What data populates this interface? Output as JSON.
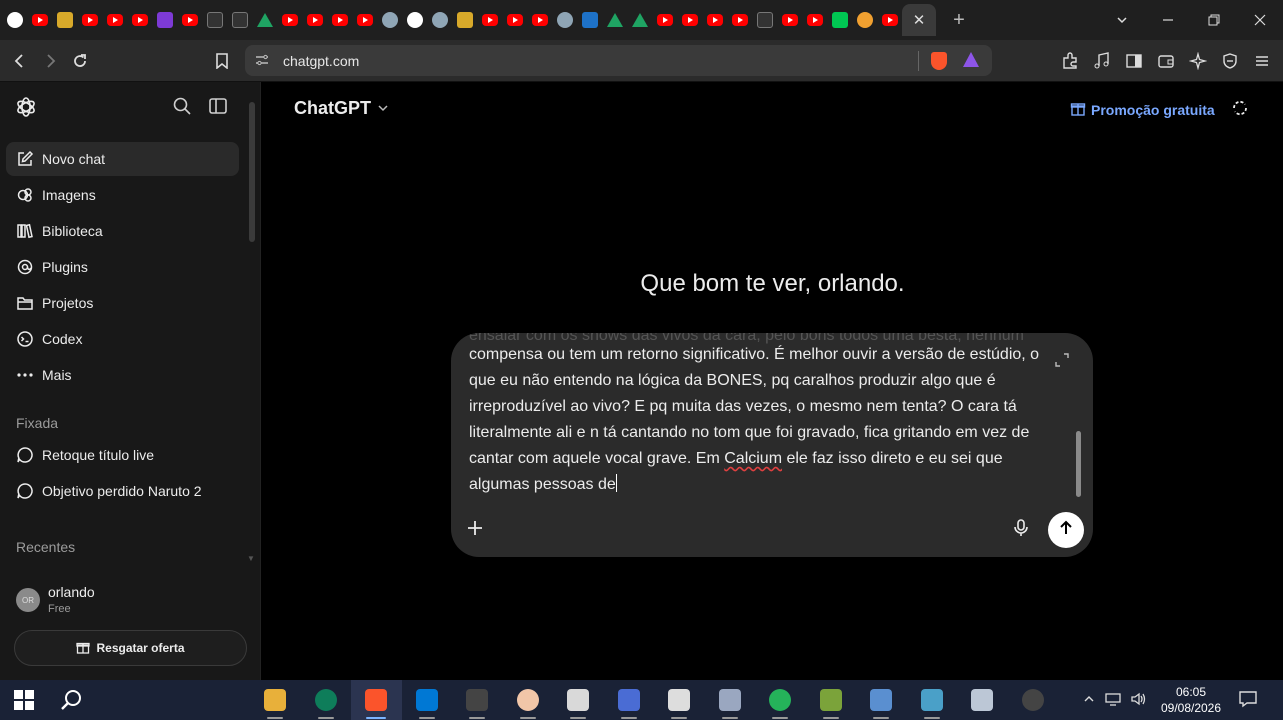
{
  "browser": {
    "url": "chatgpt.com",
    "tabs_favicons": [
      "google",
      "yt",
      "blogger",
      "yt",
      "yt",
      "yt",
      "twitch",
      "yt",
      "dark",
      "pw",
      "drive",
      "yt",
      "yt",
      "yt",
      "yt",
      "cat",
      "google",
      "cat",
      "hd",
      "yt",
      "yt",
      "yt",
      "cat",
      "blue",
      "drive",
      "drive",
      "yt",
      "yt",
      "yt",
      "yt",
      "sound",
      "yt",
      "yt",
      "kick",
      "orange",
      "yt"
    ],
    "close_tab": "✕",
    "new_tab": "+"
  },
  "sidebar": {
    "items": [
      {
        "label": "Novo chat",
        "icon": "edit-icon"
      },
      {
        "label": "Imagens",
        "icon": "images-icon"
      },
      {
        "label": "Biblioteca",
        "icon": "library-icon"
      },
      {
        "label": "Plugins",
        "icon": "plugins-icon"
      },
      {
        "label": "Projetos",
        "icon": "folder-icon"
      },
      {
        "label": "Codex",
        "icon": "codex-icon"
      },
      {
        "label": "Mais",
        "icon": "more-icon"
      }
    ],
    "pinned_title": "Fixada",
    "pinned": [
      {
        "label": "Retoque título live"
      },
      {
        "label": "Objetivo perdido Naruto 2"
      }
    ],
    "recents_title": "Recentes",
    "user": {
      "initials": "OR",
      "name": "orlando",
      "plan": "Free"
    },
    "offer_label": "Resgatar oferta"
  },
  "main": {
    "model_label": "ChatGPT",
    "promo_label": "Promoção gratuita",
    "greeting": "Que bom te ver, orlando.",
    "composer": {
      "ghost_line": "ensaiar com os shows das vivos da cara, pelo bons todos uma besta, nenhum",
      "text_before_error": "compensa ou tem um retorno significativo. É melhor ouvir a versão de estúdio, o que eu não entendo na lógica da BONES, pq caralhos produzir algo que é irreproduzível ao vivo? E pq muita das vezes, o mesmo nem tenta? O cara tá literalmente ali e n tá cantando no tom que foi gravado, fica gritando em vez de cantar com aquele vocal grave. Em ",
      "error_word": "Calcium",
      "text_after_error": " ele faz isso direto e eu sei que algumas pessoas de"
    }
  },
  "taskbar": {
    "apps": [
      "file-explorer",
      "opera-gx",
      "brave",
      "store",
      "audio-app",
      "game-character",
      "bee-app",
      "network-app",
      "wolf-app",
      "gamepad-app",
      "green-app",
      "archive-app",
      "remote-app",
      "toolkit-app",
      "laptop-app",
      "speedometer-app"
    ],
    "time": "06:05",
    "date": "09/08/2026"
  },
  "colors": {
    "accent": "#7aa8ff",
    "sidebar_bg": "#181818",
    "composer_bg": "#2b2b2b"
  }
}
